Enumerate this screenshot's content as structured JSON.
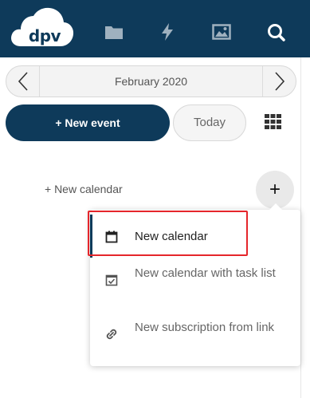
{
  "header": {
    "logo_text": "dpv",
    "nav_icons": [
      "folder-icon",
      "activity-icon",
      "photos-icon",
      "search-icon"
    ]
  },
  "datepicker": {
    "label": "February 2020",
    "prev_icon": "chevron-left-icon",
    "next_icon": "chevron-right-icon"
  },
  "actions": {
    "new_event_label": "+ New event",
    "today_label": "Today",
    "view_icon": "grid-view-icon"
  },
  "calendars": {
    "new_calendar_link": "+ New calendar",
    "add_button_symbol": "+"
  },
  "menu": {
    "items": [
      {
        "label": "New calendar",
        "icon": "calendar-icon"
      },
      {
        "label": "New calendar with task list",
        "icon": "calendar-check-icon"
      },
      {
        "label": "New subscription from link",
        "icon": "link-icon"
      }
    ]
  },
  "colors": {
    "header_bg": "#0e3a5a",
    "primary": "#0e3a5a",
    "highlight": "#e5262b"
  }
}
